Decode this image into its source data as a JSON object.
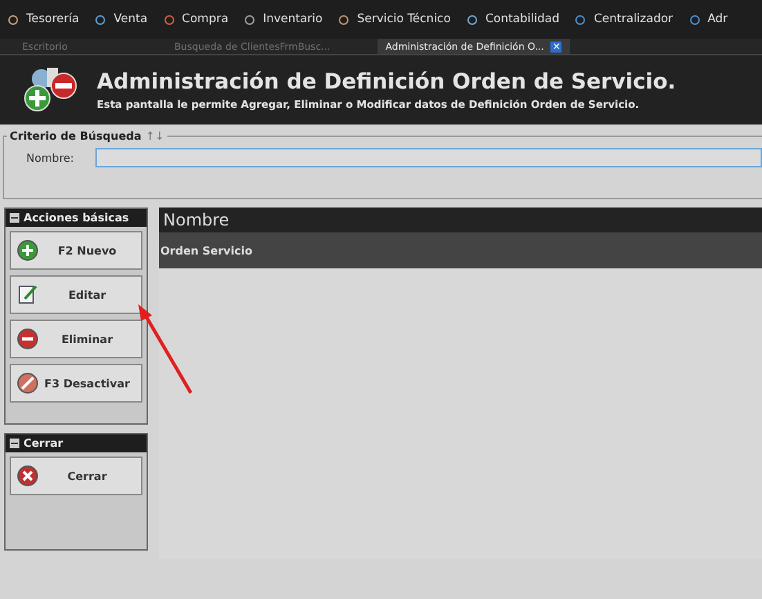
{
  "menu": [
    {
      "label": "Tesorería",
      "color": "#c8a27a"
    },
    {
      "label": "Venta",
      "color": "#5a9fd4"
    },
    {
      "label": "Compra",
      "color": "#d0603a"
    },
    {
      "label": "Inventario",
      "color": "#a0a0a0"
    },
    {
      "label": "Servicio Técnico",
      "color": "#c8956a"
    },
    {
      "label": "Contabilidad",
      "color": "#7aa8d0"
    },
    {
      "label": "Centralizador",
      "color": "#4a90d0"
    },
    {
      "label": "Adr",
      "color": "#4a90d0"
    }
  ],
  "tabs": [
    {
      "label": "Escritorio",
      "selected": false
    },
    {
      "label": "Busqueda de ClientesFrmBusc...",
      "selected": false
    },
    {
      "label": "Administración de Definición O...",
      "selected": true,
      "close": "✕"
    }
  ],
  "header": {
    "title": "Administración de Definición Orden de Servicio.",
    "subtitle": "Esta pantalla le permite Agregar, Eliminar o Modificar datos de Definición Orden de Servicio."
  },
  "search": {
    "legend": "Criterio de Búsqueda",
    "sort_arrows": "↑↓",
    "label": "Nombre:"
  },
  "actions": {
    "title": "Acciones básicas",
    "buttons": [
      {
        "label": "F2 Nuevo",
        "kind": "add"
      },
      {
        "label": "Editar",
        "kind": "edit"
      },
      {
        "label": "Eliminar",
        "kind": "delete"
      },
      {
        "label": "F3 Desactivar",
        "kind": "deactivate"
      }
    ]
  },
  "close_panel": {
    "title": "Cerrar",
    "buttons": [
      {
        "label": "Cerrar",
        "kind": "close"
      }
    ]
  },
  "table": {
    "columns": [
      "Nombre"
    ],
    "rows": [
      [
        "Orden Servicio"
      ]
    ]
  }
}
